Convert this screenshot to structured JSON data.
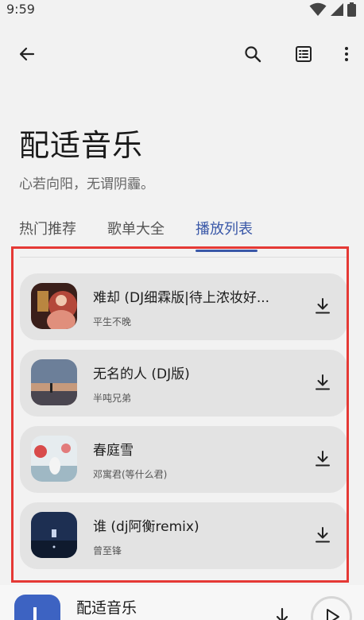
{
  "status": {
    "time": "9:59"
  },
  "toolbar": {
    "back_icon": "arrow-left-icon",
    "search_icon": "search-icon",
    "list_icon": "list-icon",
    "more_icon": "more-vert-icon"
  },
  "header": {
    "title": "配适音乐",
    "subtitle": "心若向阳，无谓阴霾。"
  },
  "tabs": [
    {
      "label": "热门推荐",
      "active": false
    },
    {
      "label": "歌单大全",
      "active": false
    },
    {
      "label": "播放列表",
      "active": true
    }
  ],
  "songs": [
    {
      "title": "难却 (DJ细霖版|待上浓妆好...",
      "artist": "平生不晚"
    },
    {
      "title": "无名的人 (DJ版)",
      "artist": "半吨兄弟"
    },
    {
      "title": "春庭雪",
      "artist": "邓寓君(等什么君)"
    },
    {
      "title": "谁 (dj阿衡remix)",
      "artist": "曾至锋"
    }
  ],
  "player": {
    "title": "配适音乐"
  },
  "colors": {
    "accent": "#3a58a8",
    "highlight_border": "#e53935",
    "card_bg": "#e3e3e3",
    "page_bg": "#f2f2f2"
  }
}
